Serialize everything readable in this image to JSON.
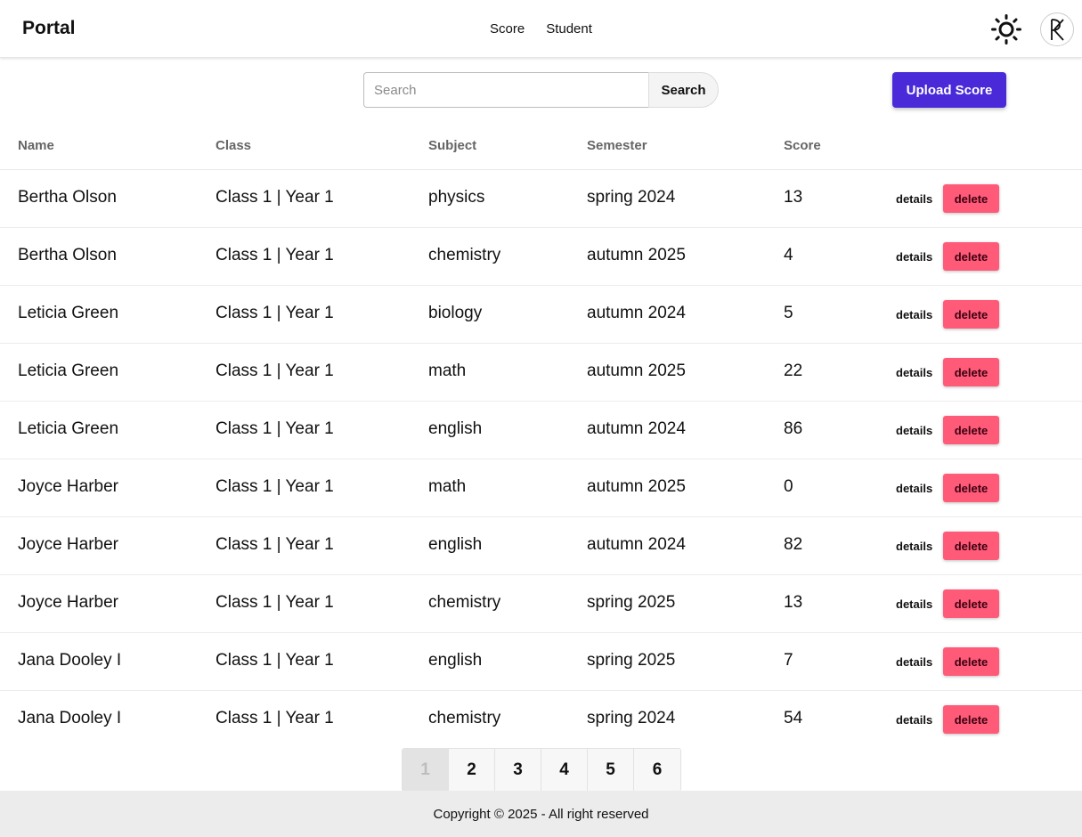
{
  "navbar": {
    "brand": "Portal",
    "links": [
      "Score",
      "Student"
    ],
    "theme_icon": "sun-icon",
    "avatar_icon": "rk-monogram-icon"
  },
  "toolbar": {
    "search_placeholder": "Search",
    "search_value": "",
    "search_button": "Search",
    "upload_button": "Upload Score"
  },
  "table": {
    "headers": [
      "Name",
      "Class",
      "Subject",
      "Semester",
      "Score"
    ],
    "rows": [
      {
        "name": "Bertha Olson",
        "class": "Class 1 | Year 1",
        "subject": "physics",
        "semester": "spring 2024",
        "score": "13"
      },
      {
        "name": "Bertha Olson",
        "class": "Class 1 | Year 1",
        "subject": "chemistry",
        "semester": "autumn 2025",
        "score": "4"
      },
      {
        "name": "Leticia Green",
        "class": "Class 1 | Year 1",
        "subject": "biology",
        "semester": "autumn 2024",
        "score": "5"
      },
      {
        "name": "Leticia Green",
        "class": "Class 1 | Year 1",
        "subject": "math",
        "semester": "autumn 2025",
        "score": "22"
      },
      {
        "name": "Leticia Green",
        "class": "Class 1 | Year 1",
        "subject": "english",
        "semester": "autumn 2024",
        "score": "86"
      },
      {
        "name": "Joyce Harber",
        "class": "Class 1 | Year 1",
        "subject": "math",
        "semester": "autumn 2025",
        "score": "0"
      },
      {
        "name": "Joyce Harber",
        "class": "Class 1 | Year 1",
        "subject": "english",
        "semester": "autumn 2024",
        "score": "82"
      },
      {
        "name": "Joyce Harber",
        "class": "Class 1 | Year 1",
        "subject": "chemistry",
        "semester": "spring 2025",
        "score": "13"
      },
      {
        "name": "Jana Dooley I",
        "class": "Class 1 | Year 1",
        "subject": "english",
        "semester": "spring 2025",
        "score": "7"
      },
      {
        "name": "Jana Dooley I",
        "class": "Class 1 | Year 1",
        "subject": "chemistry",
        "semester": "spring 2024",
        "score": "54"
      }
    ],
    "details_label": "details",
    "delete_label": "delete"
  },
  "pagination": {
    "pages": [
      "1",
      "2",
      "3",
      "4",
      "5",
      "6"
    ],
    "current": "1"
  },
  "footer": {
    "text": "Copyright © 2025 - All right reserved"
  },
  "colors": {
    "primary": "#4a2ad8",
    "danger": "#ff5a78",
    "footer_bg": "#ececec"
  }
}
